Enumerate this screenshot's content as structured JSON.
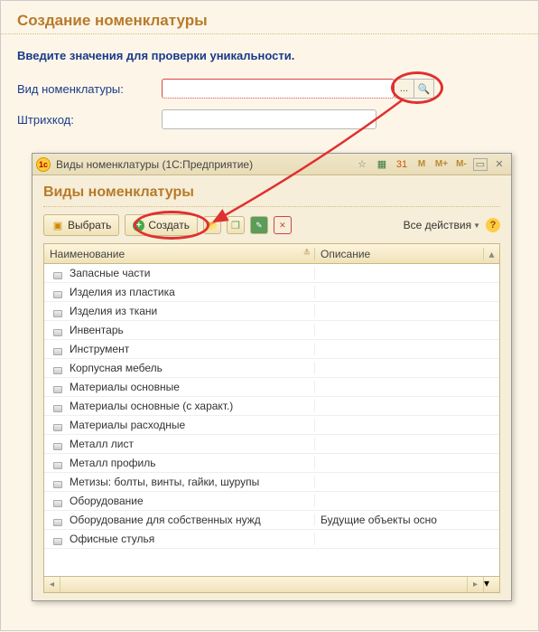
{
  "page": {
    "title": "Создание номенклатуры",
    "instruction": "Введите значения для проверки уникальности."
  },
  "form": {
    "type_label": "Вид номенклатуры:",
    "type_value": "",
    "type_ellipsis": "...",
    "barcode_label": "Штрихкод:",
    "barcode_value": ""
  },
  "dialog": {
    "app_icon": "1c",
    "window_title": "Виды номенклатуры  (1С:Предприятие)",
    "heading": "Виды номенклатуры",
    "toolbar": {
      "select": "Выбрать",
      "create": "Создать",
      "all_actions": "Все действия"
    },
    "columns": {
      "name": "Наименование",
      "desc": "Описание"
    },
    "memory_buttons": {
      "m": "M",
      "mplus": "M+",
      "mminus": "M-"
    },
    "rows": [
      {
        "name": "Запасные части",
        "desc": ""
      },
      {
        "name": "Изделия из пластика",
        "desc": ""
      },
      {
        "name": "Изделия из ткани",
        "desc": ""
      },
      {
        "name": "Инвентарь",
        "desc": ""
      },
      {
        "name": "Инструмент",
        "desc": ""
      },
      {
        "name": "Корпусная мебель",
        "desc": ""
      },
      {
        "name": "Материалы основные",
        "desc": ""
      },
      {
        "name": "Материалы основные (с характ.)",
        "desc": ""
      },
      {
        "name": "Материалы расходные",
        "desc": ""
      },
      {
        "name": "Металл лист",
        "desc": ""
      },
      {
        "name": "Металл профиль",
        "desc": ""
      },
      {
        "name": "Метизы: болты, винты, гайки, шурупы",
        "desc": ""
      },
      {
        "name": "Оборудование",
        "desc": ""
      },
      {
        "name": "Оборудование для собственных нужд",
        "desc": "Будущие объекты осно"
      },
      {
        "name": "Офисные стулья",
        "desc": ""
      }
    ]
  }
}
